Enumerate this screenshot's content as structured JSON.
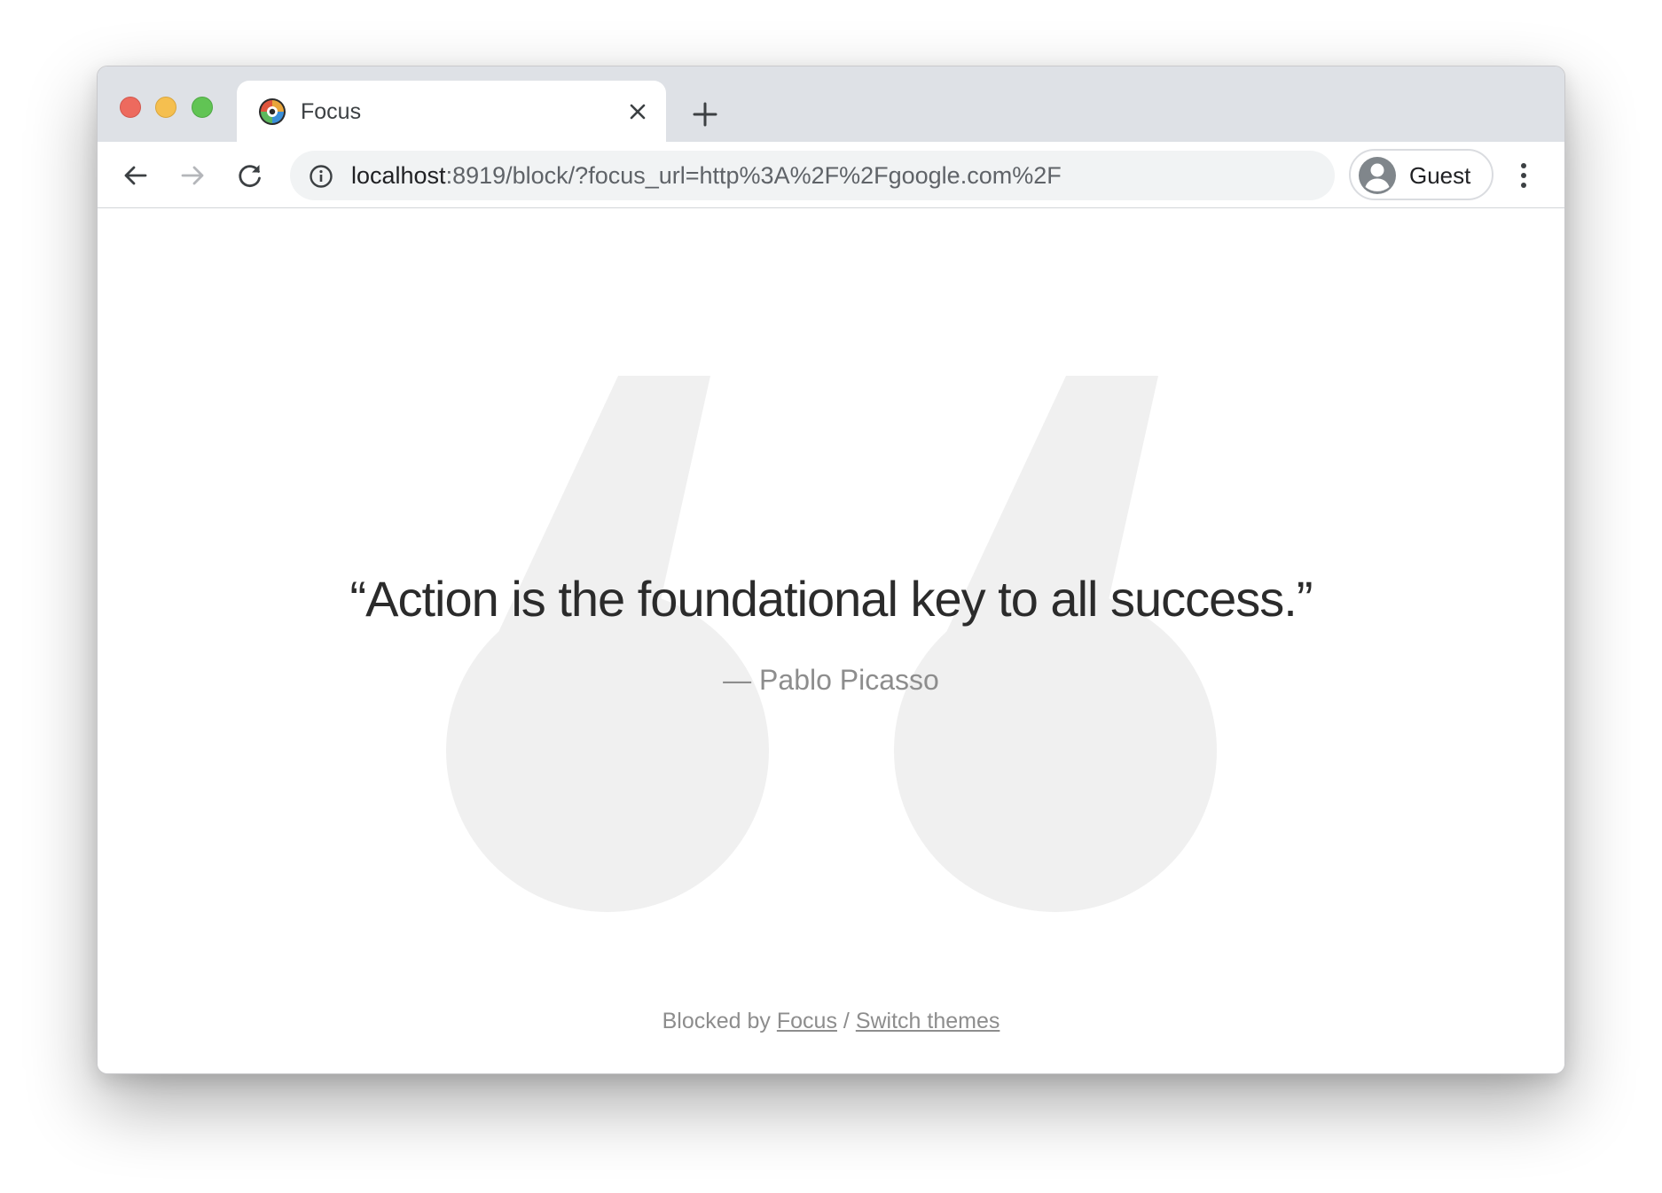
{
  "browser": {
    "tab": {
      "title": "Focus",
      "favicon": "focus-logo-icon",
      "close_icon": "close-icon"
    },
    "new_tab_icon": "plus-icon",
    "toolbar": {
      "back_icon": "arrow-left-icon",
      "forward_icon": "arrow-right-icon",
      "reload_icon": "reload-icon",
      "info_icon": "info-icon",
      "url_host": "localhost",
      "url_rest": ":8919/block/?focus_url=http%3A%2F%2Fgoogle.com%2F",
      "profile_label": "Guest",
      "profile_icon": "account-circle-icon",
      "menu_icon": "more-vertical-icon"
    },
    "traffic_lights": {
      "close": "#ed6a5e",
      "minimize": "#f5bf4f",
      "maximize": "#61c454"
    }
  },
  "page": {
    "quote": "“Action is the foundational key to all success.”",
    "author": "— Pablo Picasso",
    "background_glyph": "quote-mark-icon",
    "footer": {
      "prefix": "Blocked by",
      "focus_link": "Focus",
      "separator": "/",
      "switch_link": "Switch themes"
    }
  },
  "colors": {
    "quote_text": "#2b2b2b",
    "muted_text": "#8d8d8d",
    "quote_glyph": "#f0f0f0",
    "tabstrip": "#dee1e6",
    "omnibox": "#f1f3f4"
  }
}
